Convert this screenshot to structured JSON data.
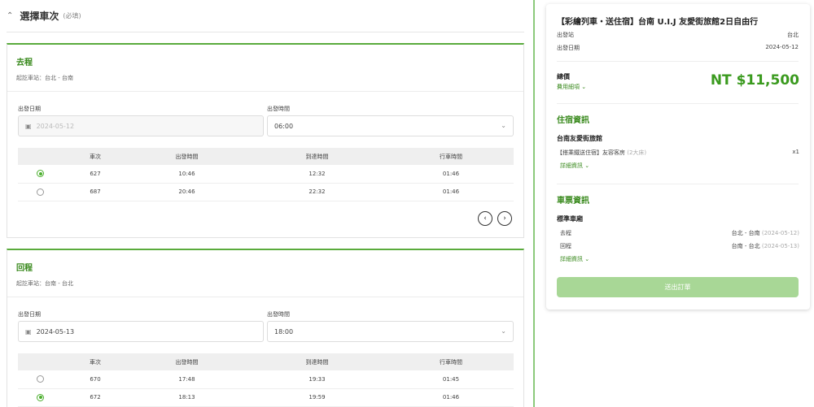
{
  "section": {
    "chevron_icon": "chevron-up-icon",
    "title": "選擇車次",
    "required": "(必填)"
  },
  "outbound": {
    "title": "去程",
    "stations": "起訖車站：台北 - 台南",
    "date_label": "出發日期",
    "date_value": "2024-05-12",
    "time_label": "出發時間",
    "time_value": "06:00",
    "headers": [
      "車次",
      "出發時間",
      "到達時間",
      "行車時間"
    ],
    "rows": [
      {
        "selected": true,
        "train": "627",
        "depart": "10:46",
        "arrive": "12:32",
        "duration": "01:46"
      },
      {
        "selected": false,
        "train": "687",
        "depart": "20:46",
        "arrive": "22:32",
        "duration": "01:46"
      }
    ],
    "prev_icon": "chevron-left-icon",
    "next_icon": "chevron-right-icon"
  },
  "return": {
    "title": "回程",
    "stations": "起訖車站：台南 - 台北",
    "date_label": "出發日期",
    "date_value": "2024-05-13",
    "time_label": "出發時間",
    "time_value": "18:00",
    "headers": [
      "車次",
      "出發時間",
      "到達時間",
      "行車時間"
    ],
    "rows": [
      {
        "selected": false,
        "train": "670",
        "depart": "17:48",
        "arrive": "19:33",
        "duration": "01:45"
      },
      {
        "selected": true,
        "train": "672",
        "depart": "18:13",
        "arrive": "19:59",
        "duration": "01:46"
      }
    ]
  },
  "summary": {
    "title": "【彩繪列車・送住宿】台南 U.I.J 友愛街旅館2日自由行",
    "origin_label": "出發站",
    "origin_value": "台北",
    "date_label": "出發日期",
    "date_value": "2024-05-12",
    "total_label": "總價",
    "fee_link": "費用細項",
    "total_price": "NT $11,500",
    "lodging_title": "住宿資訊",
    "hotel_name": "台南友愛街旅館",
    "room_text": "【搭乘鐵送住宿】友容客房",
    "room_note": "(2大床)",
    "room_qty": "x1",
    "lodging_detail": "詳細資訊",
    "ticket_title": "車票資訊",
    "car_class": "標準車廂",
    "out_label": "去程",
    "out_route": "台北 - 台南",
    "out_date": "(2024-05-12)",
    "ret_label": "回程",
    "ret_route": "台南 - 台北",
    "ret_date": "(2024-05-13)",
    "ticket_detail": "詳細資訊",
    "submit": "送出訂單"
  },
  "colors": {
    "accent": "#3a8a1e",
    "brand_green": "#5aab3c",
    "button_disabled": "#a8d796"
  }
}
